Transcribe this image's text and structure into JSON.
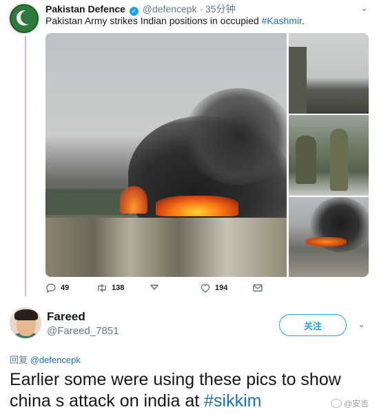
{
  "tweet": {
    "author_name": "Pakistan Defence",
    "handle": "@defencepk",
    "separator": "·",
    "time": "35分钟",
    "text_before": "Pakistan Army strikes Indian positions in occupied ",
    "hashtag": "#Kashmir",
    "text_after": ".",
    "stats": {
      "replies": "49",
      "retweets": "138",
      "likes": "194"
    }
  },
  "reply": {
    "author_name": "Fareed",
    "handle": "@Fareed_7851",
    "follow_label": "关注",
    "reply_prefix": "回复",
    "reply_mention": "@defencepk",
    "text_before": "Earlier some were using these pics to show china s attack on india at ",
    "hashtag": "#sikkim"
  },
  "icons": {
    "verified": "verified-check-icon",
    "reply": "reply-icon",
    "retweet": "retweet-icon",
    "heart_down": "heart-down-icon",
    "like": "like-icon",
    "message": "envelope-icon",
    "caret": "chevron-down-icon"
  },
  "watermark": {
    "text": "@安吉"
  },
  "colors": {
    "link": "#1b6fbf",
    "accent": "#1da1f2",
    "thread": "#c5b8ea",
    "muted": "#657786"
  }
}
